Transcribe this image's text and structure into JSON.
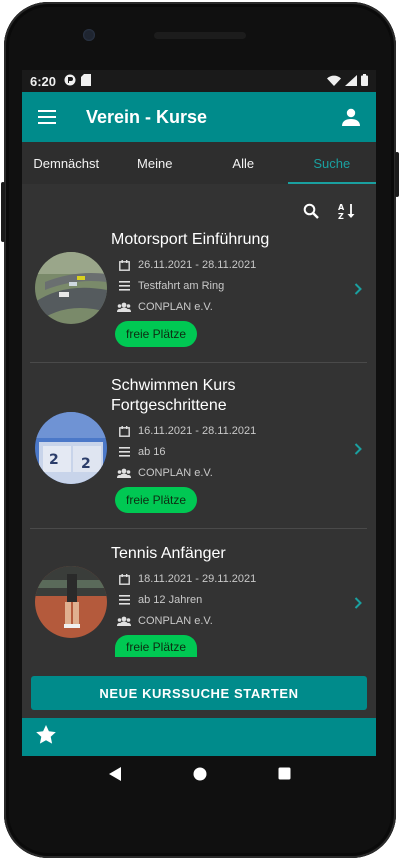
{
  "statusbar": {
    "time": "6:20",
    "icons_left": [
      "app-notification-icon",
      "sd-card-icon"
    ],
    "icons_right": [
      "wifi-icon",
      "signal-icon",
      "battery-icon"
    ]
  },
  "appbar": {
    "title": "Verein - Kurse",
    "menu_icon": "menu-icon",
    "user_icon": "user-icon"
  },
  "tabs": [
    {
      "label": "Demnächst",
      "active": false
    },
    {
      "label": "Meine",
      "active": false
    },
    {
      "label": "Alle",
      "active": false
    },
    {
      "label": "Suche",
      "active": true
    }
  ],
  "toolbar": {
    "search_icon": "search-icon",
    "sort_icon": "sort-alpha-icon"
  },
  "courses": [
    {
      "title": "Motorsport Einführung",
      "dates": "26.11.2021 - 28.11.2021",
      "info": "Testfahrt am Ring",
      "organizer": "CONPLAN e.V.",
      "badge": "freie Plätze",
      "image": "motorsport-photo"
    },
    {
      "title": "Schwimmen Kurs Fortgeschrittene",
      "dates": "16.11.2021 - 28.11.2021",
      "info": "ab 16",
      "organizer": "CONPLAN e.V.",
      "badge": "freie Plätze",
      "image": "swimming-photo"
    },
    {
      "title": "Tennis Anfänger",
      "dates": "18.11.2021 - 29.11.2021",
      "info": "ab 12 Jahren",
      "organizer": "CONPLAN e.V.",
      "badge": "freie Plätze",
      "image": "tennis-photo"
    }
  ],
  "cta": {
    "label": "NEUE KURSSUCHE STARTEN"
  },
  "bottombar": {
    "icon": "star-icon"
  },
  "navbar": {
    "icons": [
      "back-icon",
      "home-icon",
      "recents-icon"
    ]
  },
  "colors": {
    "accent": "#008b8b",
    "tab_active": "#1aa0a0",
    "badge": "#00c853",
    "background": "#333333"
  }
}
